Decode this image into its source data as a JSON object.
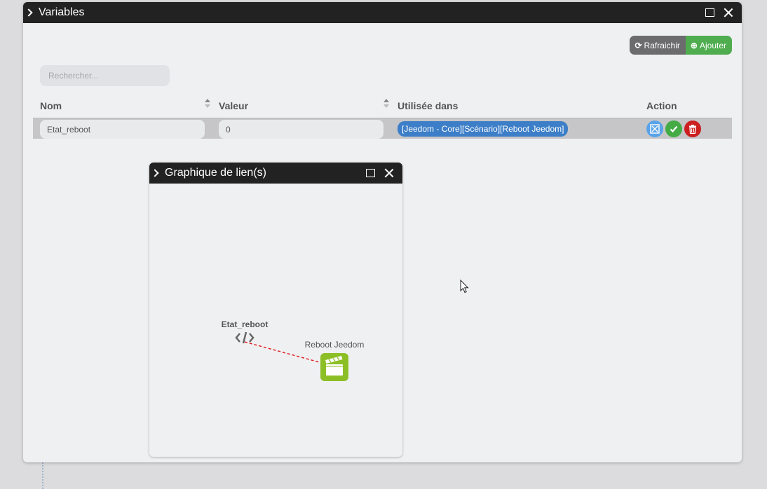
{
  "window": {
    "title": "Variables"
  },
  "toolbar": {
    "refresh_label": "Rafraichir",
    "add_label": "Ajouter"
  },
  "search": {
    "placeholder": "Rechercher..."
  },
  "table": {
    "headers": [
      "Nom",
      "Valeur",
      "Utilisée dans",
      "Action"
    ],
    "rows": [
      {
        "name": "Etat_reboot",
        "value": "0",
        "used_in": "[Jeedom - Core][Scénario][Reboot Jeedom]",
        "actions": [
          "link-graph-icon",
          "check-icon",
          "trash-icon"
        ]
      }
    ]
  },
  "graph_window": {
    "title": "Graphique de lien(s)",
    "nodes": [
      {
        "label": "Etat_reboot",
        "icon": "code-icon"
      },
      {
        "label": "Reboot Jeedom",
        "icon": "scenario-clapperboard-icon"
      }
    ],
    "link_color": "#e02020"
  },
  "colors": {
    "titlebar": "#222222",
    "add_button": "#4fad4f",
    "refresh_button": "#6c6c6e",
    "tag": "#3c7ec7",
    "scenario_node": "#8cbf26"
  }
}
